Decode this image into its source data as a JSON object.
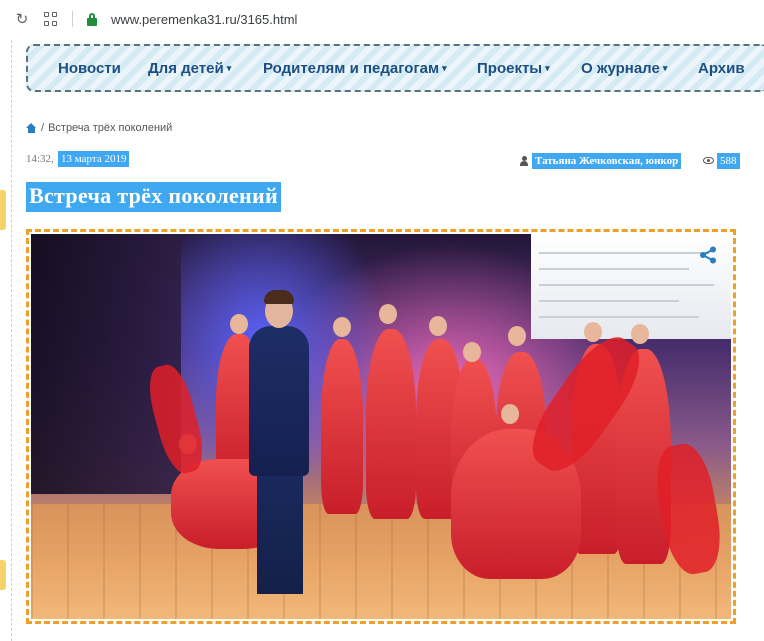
{
  "browser": {
    "reload_icon": "reload-icon",
    "apps_icon": "apps-grid-icon",
    "lock_icon": "lock-icon",
    "url": "www.peremenka31.ru/3165.html"
  },
  "nav": {
    "items": [
      {
        "label": "Новости",
        "has_caret": false
      },
      {
        "label": "Для детей",
        "has_caret": true
      },
      {
        "label": "Родителям и педагогам",
        "has_caret": true
      },
      {
        "label": "Проекты",
        "has_caret": true
      },
      {
        "label": "О журнале",
        "has_caret": true
      },
      {
        "label": "Архив",
        "has_caret": false
      }
    ],
    "caret": "▾"
  },
  "breadcrumb": {
    "home_icon": "home-icon",
    "separator": "/",
    "current": "Встреча трёх поколений"
  },
  "meta": {
    "time": "14:32,",
    "date": "13 марта 2019",
    "author": "Татьяна Жечковская, юнкор",
    "views": "588"
  },
  "article": {
    "title": "Встреча трёх поколений",
    "share_icon": "share-icon"
  },
  "colors": {
    "highlight": "#3fa8f0",
    "nav_text": "#1d4f82",
    "photo_border": "#f0a028"
  }
}
